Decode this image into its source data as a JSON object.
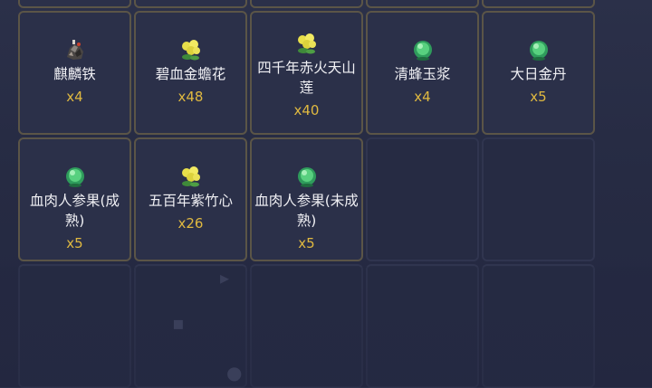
{
  "inventory": {
    "items": [
      {
        "name": "",
        "qty": "",
        "icon": "none"
      },
      {
        "name": "",
        "qty": "",
        "icon": "none"
      },
      {
        "name": "",
        "qty": "",
        "icon": "none"
      },
      {
        "name": "",
        "qty": "",
        "icon": "none"
      },
      {
        "name": "",
        "qty": "",
        "icon": "none"
      },
      {
        "name": "麒麟铁",
        "qty": "x4",
        "icon": "ore-icon"
      },
      {
        "name": "碧血金蟾花",
        "qty": "x48",
        "icon": "yellow-flower-icon"
      },
      {
        "name": "四千年赤火天山莲",
        "qty": "x40",
        "icon": "yellow-flower-icon"
      },
      {
        "name": "清蜂玉浆",
        "qty": "x4",
        "icon": "green-herb-icon"
      },
      {
        "name": "大日金丹",
        "qty": "x5",
        "icon": "green-herb-icon"
      },
      {
        "name": "血肉人参果(成熟)",
        "qty": "x5",
        "icon": "green-herb-icon"
      },
      {
        "name": "五百年紫竹心",
        "qty": "x26",
        "icon": "yellow-flower-icon"
      },
      {
        "name": "血肉人参果(未成熟)",
        "qty": "x5",
        "icon": "green-herb-icon"
      }
    ],
    "empty_slots": 7
  },
  "colors": {
    "quantity": "#e0b940",
    "slot_border": "#5b5547",
    "background": "#262b43"
  }
}
